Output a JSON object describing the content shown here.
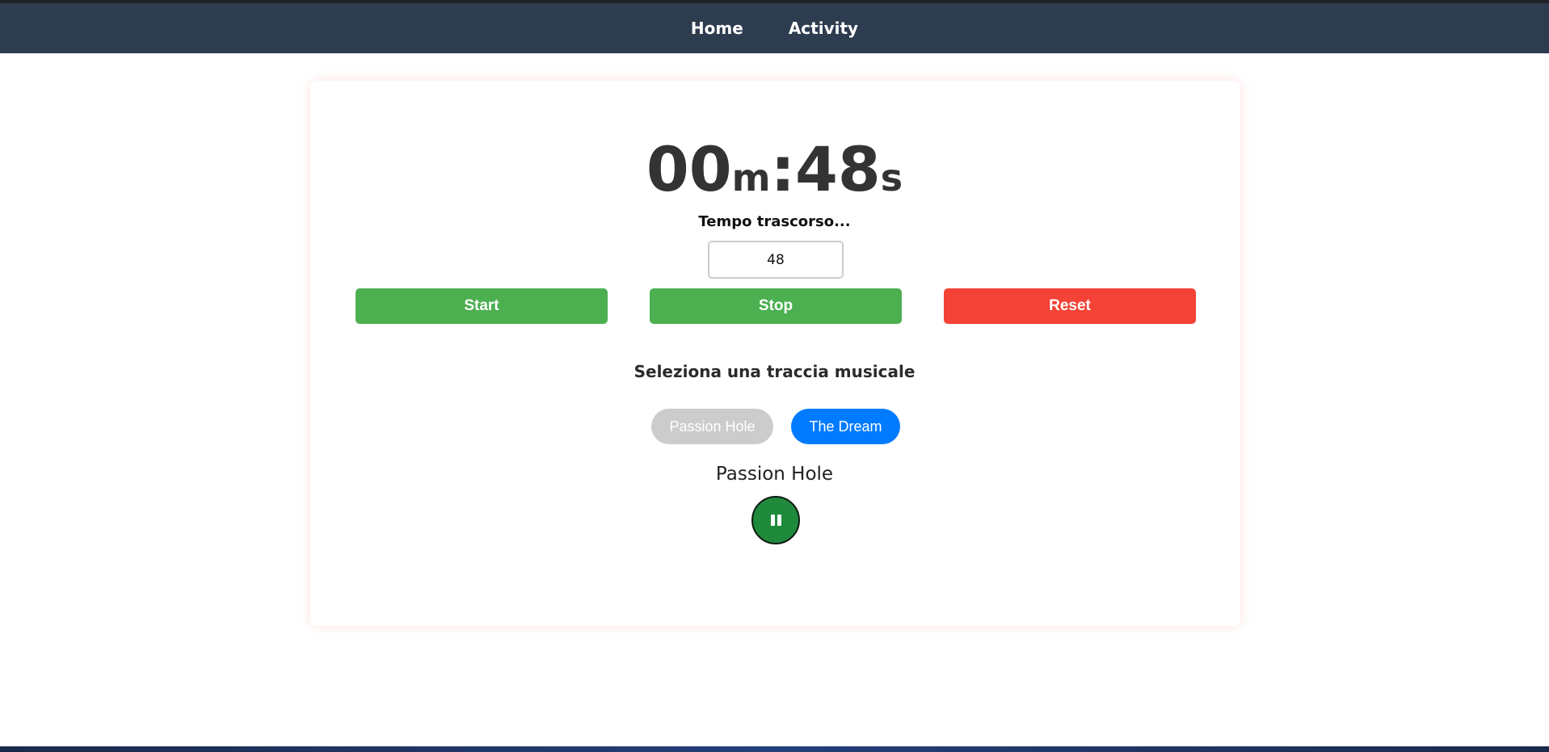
{
  "nav": {
    "items": [
      {
        "label": "Home"
      },
      {
        "label": "Activity"
      }
    ]
  },
  "timer": {
    "minutes": "00",
    "minutes_unit": "m",
    "separator": ":",
    "seconds": "48",
    "seconds_unit": "s",
    "status_label": "Tempo trascorso...",
    "input_value": "48"
  },
  "controls": {
    "start_label": "Start",
    "stop_label": "Stop",
    "reset_label": "Reset"
  },
  "music": {
    "heading": "Seleziona una traccia musicale",
    "tracks": [
      {
        "label": "Passion Hole",
        "color": "#cccccc"
      },
      {
        "label": "The Dream",
        "color": "#007bff"
      }
    ],
    "now_playing": "Passion Hole",
    "player_icon": "pause-icon"
  },
  "colors": {
    "navbar": "#2e3c50",
    "start": "#4caf50",
    "stop": "#4caf50",
    "reset": "#f44336",
    "player": "#1f8a3c"
  }
}
